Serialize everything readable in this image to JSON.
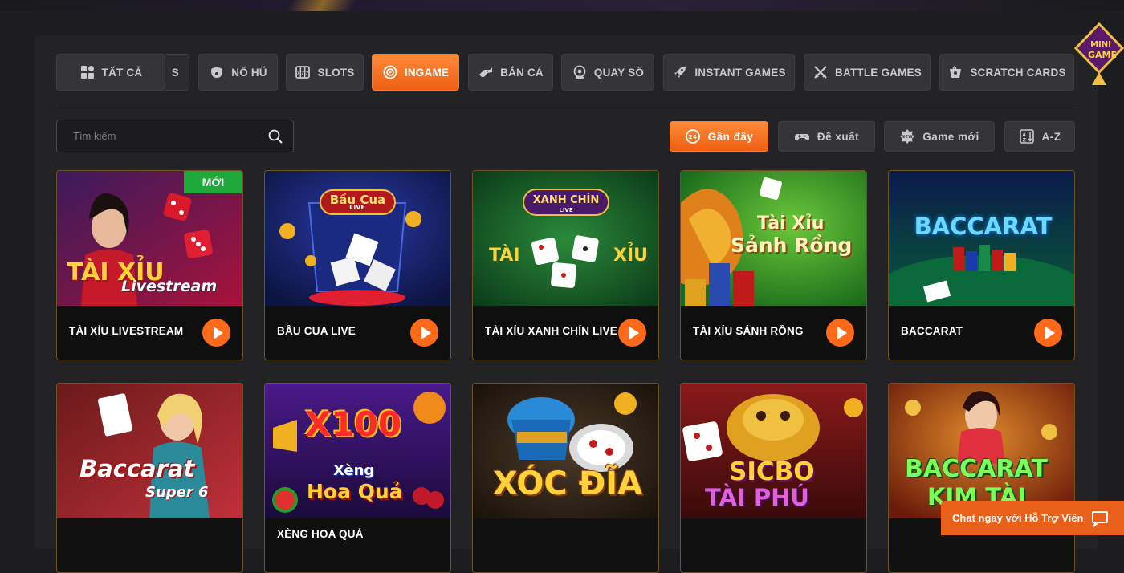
{
  "tabs": [
    {
      "label": "TẤT CẢ",
      "icon": "grid-icon",
      "active": false
    },
    {
      "label": "S",
      "icon": "",
      "active": false
    },
    {
      "label": "NỔ HŨ",
      "icon": "pot-icon",
      "active": false
    },
    {
      "label": "SLOTS",
      "icon": "slot-machine-icon",
      "active": false
    },
    {
      "label": "INGAME",
      "icon": "target-icon",
      "active": true
    },
    {
      "label": "BẮN CÁ",
      "icon": "fish-gun-icon",
      "active": false
    },
    {
      "label": "QUAY SỐ",
      "icon": "lottery-icon",
      "active": false
    },
    {
      "label": "INSTANT GAMES",
      "icon": "rocket-icon",
      "active": false
    },
    {
      "label": "BATTLE GAMES",
      "icon": "swords-icon",
      "active": false
    },
    {
      "label": "SCRATCH CARDS",
      "icon": "scratch-card-icon",
      "active": false
    }
  ],
  "search": {
    "placeholder": "Tìm kiếm"
  },
  "sort": [
    {
      "label": "Gần đây",
      "icon": "clock-24-icon",
      "active": true
    },
    {
      "label": "Đề xuất",
      "icon": "gamepad-icon",
      "active": false
    },
    {
      "label": "Game mới",
      "icon": "new-badge-icon",
      "active": false
    },
    {
      "label": "A-Z",
      "icon": "sort-az-icon",
      "active": false
    }
  ],
  "games_row1": [
    {
      "title": "TÀI XỈU LIVESTREAM",
      "badge": "MỚI",
      "art_line1": "TÀI XỈU",
      "art_line2": "Livestream"
    },
    {
      "title": "BẦU CUA LIVE",
      "art_line1": "Bầu Cua",
      "art_line2": "LIVE"
    },
    {
      "title": "TÀI XỈU XANH CHÍN LIVE",
      "art_line1": "XANH CHÍN",
      "art_line2": "LIVE",
      "art_left": "TÀI",
      "art_right": "XỈU"
    },
    {
      "title": "TÀI XỈU SẢNH RỒNG",
      "art_line1": "Tài Xỉu",
      "art_line2": "Sảnh Rồng"
    },
    {
      "title": "BACCARAT",
      "art_line1": "BACCARAT"
    }
  ],
  "games_row2": [
    {
      "art_line1": "Baccarat",
      "art_line2": "Super 6"
    },
    {
      "title": "XÈNG HOA QUẢ",
      "art_line1": "X100",
      "art_line2": "Xèng",
      "art_line3": "Hoa Quả"
    },
    {
      "art_line1": "XÓC ĐĨA"
    },
    {
      "art_line1": "SICBO",
      "art_line2": "TÀI PHÚ"
    },
    {
      "art_line1": "BACCARAT",
      "art_line2": "KIM TÀI"
    }
  ],
  "mini_game": {
    "line1": "MINI",
    "line2": "GAME"
  },
  "chat": {
    "label": "Chat ngay với Hỗ Trợ Viên"
  },
  "colors": {
    "accent": "#ff6a1a",
    "new_badge": "#1fa83a",
    "card_border": "#6b5426"
  }
}
